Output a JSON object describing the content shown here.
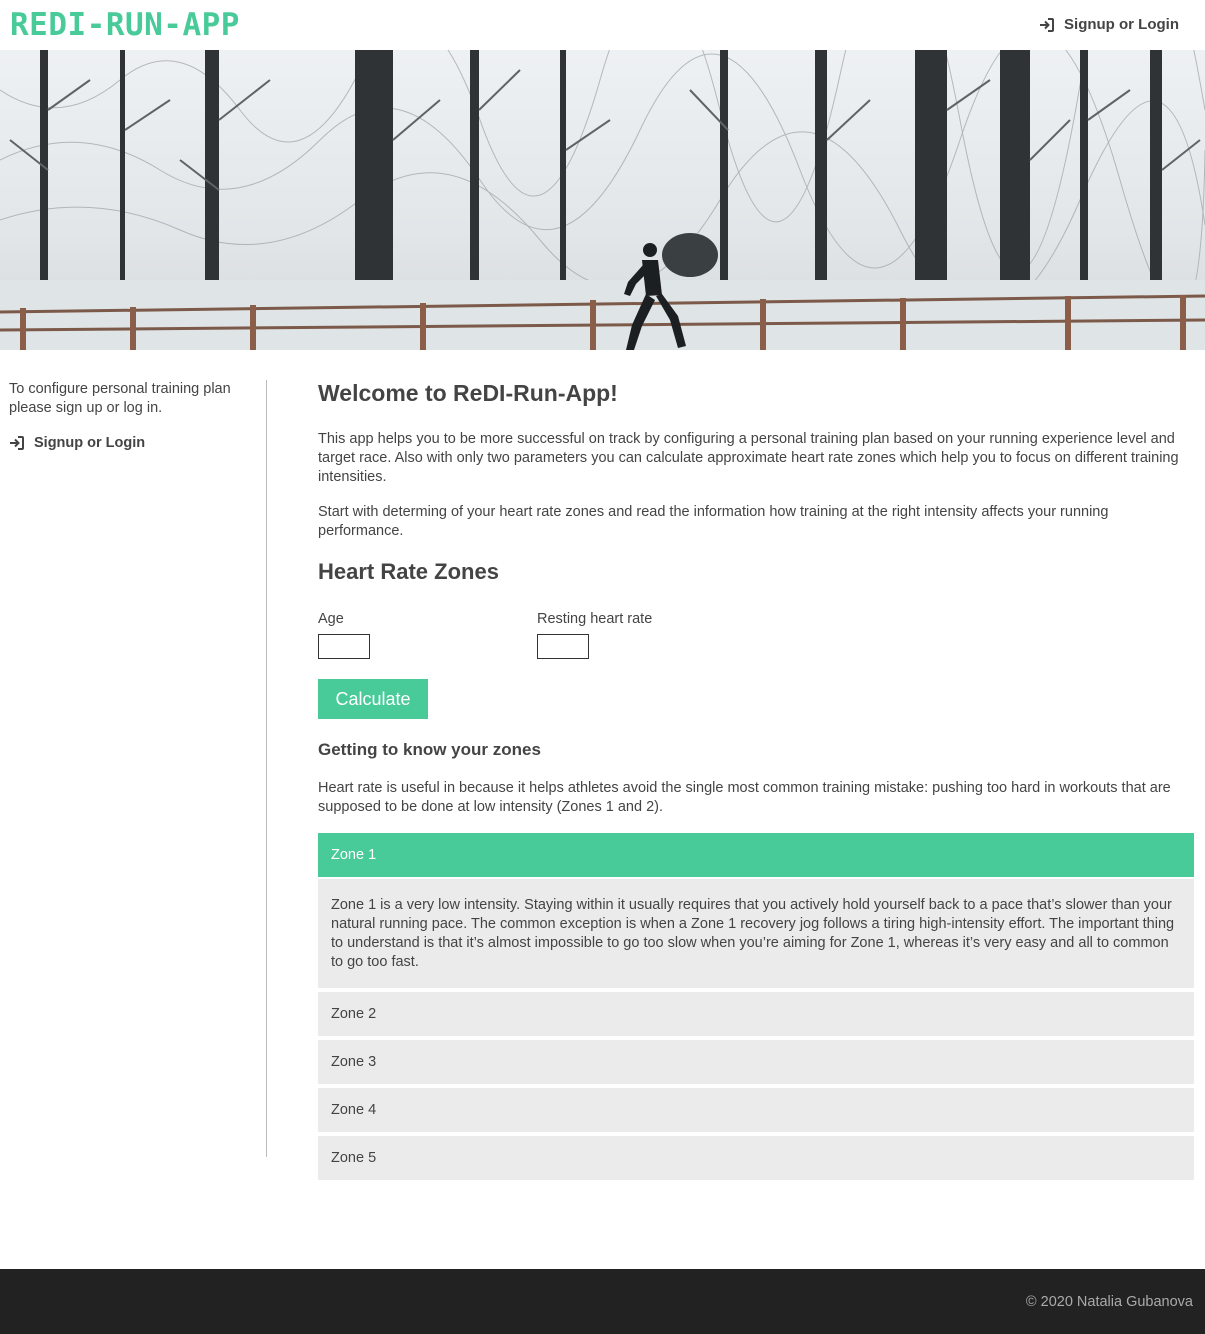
{
  "header": {
    "logo": "REDI-RUN-APP",
    "login_label": "Signup or Login",
    "accent_color": "#48cb98"
  },
  "hero": {
    "image_desc": "snowy forest with runner on boardwalk"
  },
  "sidebar": {
    "text": "To configure personal training plan please sign up or log in.",
    "login_label": "Signup or Login"
  },
  "main": {
    "welcome_title": "Welcome to ReDI-Run-App!",
    "intro": "This app helps you to be more successful on track by configuring a personal training plan based on your running experience level and target race. Also with only two parameters you can calculate approximate heart rate zones which help you to focus on different training intensities.",
    "intro2": "Start with determing of your heart rate zones and read the information how training at the right intensity affects your running performance.",
    "heart_rate_title": "Heart Rate Zones",
    "age_label": "Age",
    "age_value": "",
    "resting_label": "Resting heart rate",
    "resting_value": "",
    "calculate_label": "Calculate",
    "zones_title": "Getting to know your zones",
    "zones_desc": "Heart rate is useful in because it helps athletes avoid the single most common training mistake: pushing too hard in workouts that are supposed to be done at low intensity (Zones 1 and 2).",
    "zones": [
      {
        "label": "Zone 1",
        "expanded": true,
        "body": "Zone 1 is a very low intensity. Staying within it usually requires that you actively hold yourself back to a pace that’s slower than your natural running pace. The common exception is when a Zone 1 recovery jog follows a tiring high-intensity effort. The important thing to understand is that it’s almost impossible to go too slow when you’re aiming for Zone 1, whereas it’s very easy and all to common to go too fast."
      },
      {
        "label": "Zone 2",
        "expanded": false
      },
      {
        "label": "Zone 3",
        "expanded": false
      },
      {
        "label": "Zone 4",
        "expanded": false
      },
      {
        "label": "Zone 5",
        "expanded": false
      }
    ]
  },
  "footer": {
    "copyright": "© 2020 Natalia Gubanova"
  }
}
